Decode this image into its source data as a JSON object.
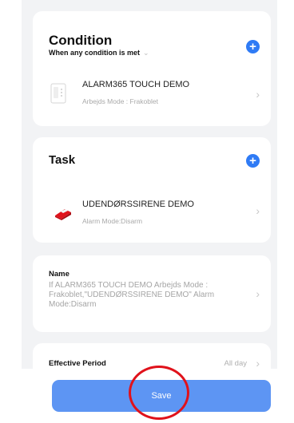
{
  "condition": {
    "title": "Condition",
    "subtitle": "When any condition is met",
    "subtitle_chevron": "⌄",
    "device": {
      "name": "ALARM365 TOUCH DEMO",
      "status": "Arbejds Mode : Frakoblet",
      "icon": "control-panel-icon"
    }
  },
  "task": {
    "title": "Task",
    "device": {
      "name": "UDENDØRSSIRENE DEMO",
      "status": "Alarm Mode:Disarm",
      "icon": "siren-icon"
    }
  },
  "name_card": {
    "label": "Name",
    "value": "If ALARM365 TOUCH DEMO Arbejds Mode : Frakoblet,\"UDENDØRSSIRENE DEMO\" Alarm Mode:Disarm"
  },
  "effective_period": {
    "label": "Effective Period",
    "value": "All day"
  },
  "footer": {
    "save_label": "Save"
  },
  "icons": {
    "plus": "+",
    "chevron": "›"
  },
  "colors": {
    "accent": "#2f7bf5",
    "save_button": "#5d95f3",
    "highlight": "#e0121b",
    "siren_red": "#e0121b"
  }
}
